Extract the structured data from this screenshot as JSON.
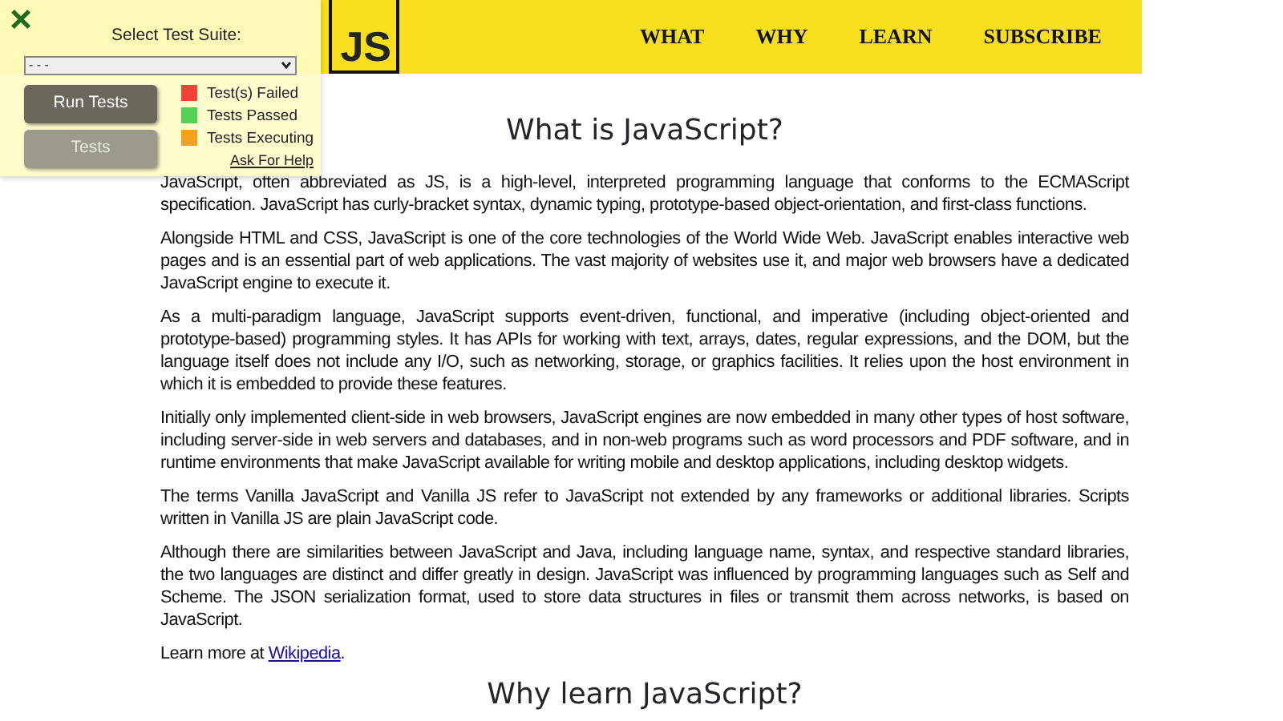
{
  "header": {
    "logo": "JS",
    "nav": [
      "WHAT",
      "WHY",
      "LEARN",
      "SUBSCRIBE"
    ]
  },
  "sections": [
    {
      "heading": "What is JavaScript?",
      "paragraphs": [
        "JavaScript, often abbreviated as JS, is a high-level, interpreted programming language that conforms to the ECMAScript specification. JavaScript has curly-bracket syntax, dynamic typing, prototype-based object-orientation, and first-class functions.",
        "Alongside HTML and CSS, JavaScript is one of the core technologies of the World Wide Web. JavaScript enables interactive web pages and is an essential part of web applications. The vast majority of websites use it, and major web browsers have a dedicated JavaScript engine to execute it.",
        "As a multi-paradigm language, JavaScript supports event-driven, functional, and imperative (including object-oriented and prototype-based) programming styles. It has APIs for working with text, arrays, dates, regular expressions, and the DOM, but the language itself does not include any I/O, such as networking, storage, or graphics facilities. It relies upon the host environment in which it is embedded to provide these features.",
        "Initially only implemented client-side in web browsers, JavaScript engines are now embedded in many other types of host software, including server-side in web servers and databases, and in non-web programs such as word processors and PDF software, and in runtime environments that make JavaScript available for writing mobile and desktop applications, including desktop widgets.",
        "The terms Vanilla JavaScript and Vanilla JS refer to JavaScript not extended by any frameworks or additional libraries. Scripts written in Vanilla JS are plain JavaScript code.",
        "Although there are similarities between JavaScript and Java, including language name, syntax, and respective standard libraries, the two languages are distinct and differ greatly in design. JavaScript was influenced by programming languages such as Self and Scheme. The JSON serialization format, used to store data structures in files or transmit them across networks, is based on JavaScript."
      ],
      "more": {
        "before": "Learn more at ",
        "link": "Wikipedia",
        "after": "."
      }
    },
    {
      "heading": "Why learn JavaScript?"
    }
  ],
  "test_panel": {
    "close": "×",
    "label": "Select Test Suite:",
    "select_value": "- - -",
    "buttons": [
      {
        "label": "Run Tests",
        "disabled": false
      },
      {
        "label": "Tests",
        "disabled": true
      }
    ],
    "legend": [
      {
        "label": "Test(s) Failed",
        "color": "#f44336"
      },
      {
        "label": "Tests Passed",
        "color": "#55d055"
      },
      {
        "label": "Tests Executing",
        "color": "#f5a020"
      }
    ],
    "help": "Ask For Help"
  }
}
